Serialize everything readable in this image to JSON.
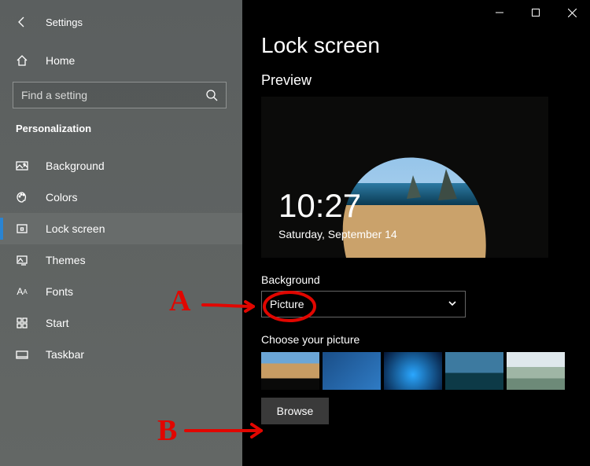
{
  "window": {
    "title": "Settings"
  },
  "sidebar": {
    "home": "Home",
    "search_placeholder": "Find a setting",
    "section": "Personalization",
    "items": [
      {
        "label": "Background"
      },
      {
        "label": "Colors"
      },
      {
        "label": "Lock screen"
      },
      {
        "label": "Themes"
      },
      {
        "label": "Fonts"
      },
      {
        "label": "Start"
      },
      {
        "label": "Taskbar"
      }
    ],
    "selected_index": 2
  },
  "main": {
    "heading": "Lock screen",
    "preview_label": "Preview",
    "clock": "10:27",
    "date": "Saturday, September 14",
    "background_label": "Background",
    "background_value": "Picture",
    "choose_label": "Choose your picture",
    "browse_label": "Browse"
  },
  "annotations": {
    "a_label": "A",
    "b_label": "B"
  }
}
